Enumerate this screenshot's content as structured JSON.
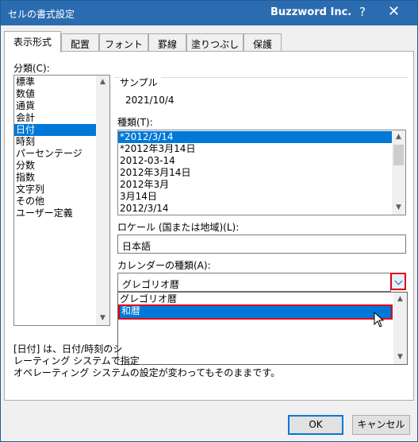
{
  "window": {
    "title": "セルの書式設定",
    "brand": "Buzzword Inc.",
    "help_glyph": "?",
    "close_glyph": "✕"
  },
  "tabs": [
    {
      "label": "表示形式",
      "active": true
    },
    {
      "label": "配置"
    },
    {
      "label": "フォント"
    },
    {
      "label": "罫線"
    },
    {
      "label": "塗りつぶし"
    },
    {
      "label": "保護"
    }
  ],
  "category": {
    "label": "分類(C):",
    "items": [
      "標準",
      "数値",
      "通貨",
      "会計",
      "日付",
      "時刻",
      "パーセンテージ",
      "分数",
      "指数",
      "文字列",
      "その他",
      "ユーザー定義"
    ],
    "selected": "日付"
  },
  "sample": {
    "label": "サンプル",
    "value": "2021/10/4"
  },
  "type": {
    "label": "種類(T):",
    "items": [
      "*2012/3/14",
      "*2012年3月14日",
      "2012-03-14",
      "2012年3月14日",
      "2012年3月",
      "3月14日",
      "2012/3/14"
    ],
    "selected": "*2012/3/14"
  },
  "locale": {
    "label": "ロケール (国または地域)(L):",
    "value": "日本語"
  },
  "calendar": {
    "label": "カレンダーの種類(A):",
    "value": "グレゴリオ暦",
    "options": [
      "グレゴリオ暦",
      "和暦"
    ],
    "highlighted": "和暦"
  },
  "description": {
    "line1": "[日付] は、日付/時刻のシ",
    "line2": "レーティング システムで指定",
    "line3": "オペレーティング システムの設定が変わってもそのままです。"
  },
  "buttons": {
    "ok": "OK",
    "cancel": "キャンセル"
  },
  "colors": {
    "titlebar": "#2b6cb0",
    "selection": "#0078d7",
    "highlight_border": "#e0001a"
  },
  "icons": {
    "scroll_up": "chevron-up-icon",
    "scroll_down": "chevron-down-icon",
    "dropdown": "chevron-down-icon",
    "cursor": "arrow-cursor-icon"
  }
}
